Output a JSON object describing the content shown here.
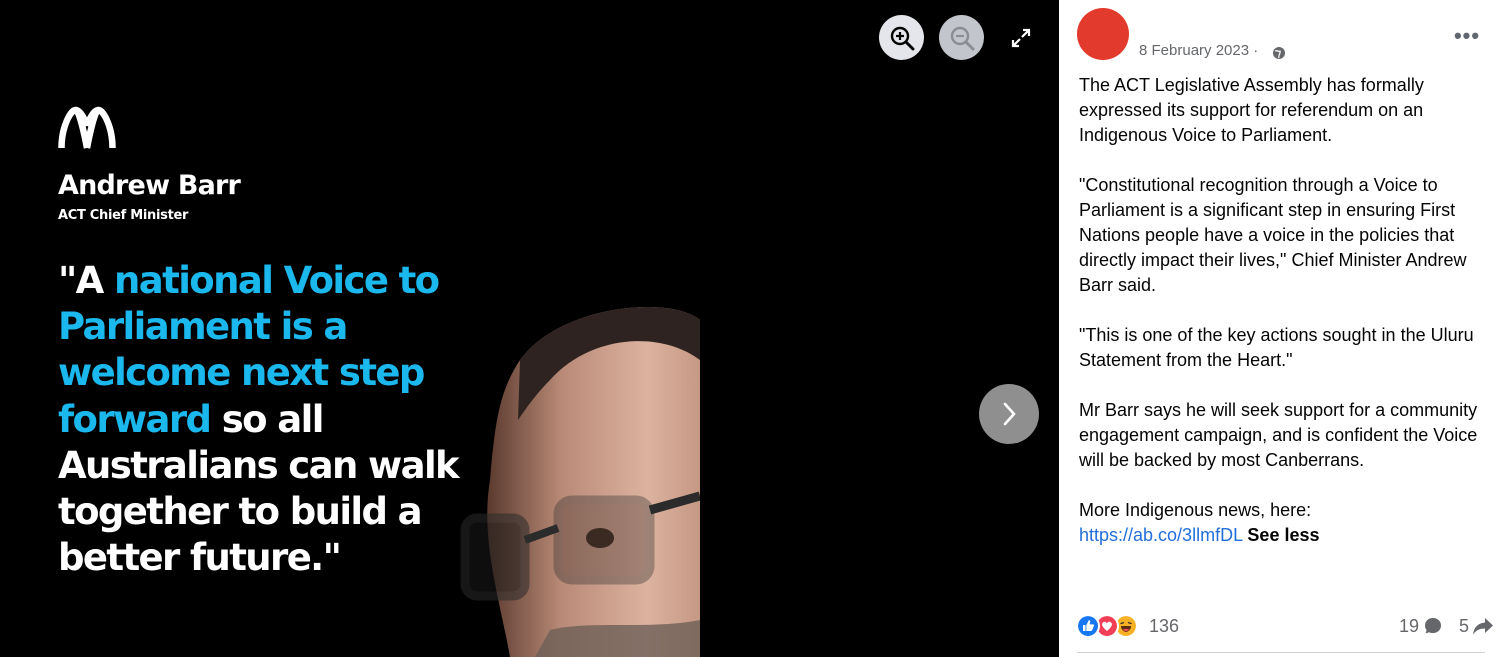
{
  "media": {
    "logo": "ABC",
    "author_name": "Andrew Barr",
    "author_role": "ACT Chief Minister",
    "quote": {
      "part1": "\"A ",
      "highlight": "national Voice to Parliament is a welcome next step forward",
      "part2": " so all Australians can walk together to build a better future.\""
    },
    "highlight_color": "#1bb8ee",
    "controls": {
      "zoom_in_icon": "zoom-in-icon",
      "zoom_out_icon": "zoom-out-icon",
      "fullscreen_icon": "fullscreen-icon",
      "next_icon": "chevron-right-icon"
    }
  },
  "post": {
    "date": "8 February 2023 ·",
    "privacy_icon": "globe-icon",
    "more_label": "•••",
    "paragraphs": [
      "The ACT Legislative Assembly has formally expressed its support for referendum on an Indigenous Voice to Parliament.",
      "\"Constitutional recognition through a Voice to Parliament is a significant step in ensuring First Nations people have a voice in the policies that directly impact their lives,\" Chief Minister Andrew Barr said.",
      "\"This is one of the key actions sought in the Uluru Statement from the Heart.\"",
      "Mr Barr says he will seek support for a community engagement campaign, and is confident the Voice will be backed by most Canberrans."
    ],
    "more_news_label": "More Indigenous news, here:",
    "link": "https://ab.co/3llmfDL",
    "see_less": "See less",
    "link_color": "#216fdb"
  },
  "reactions": {
    "icons": [
      "like-icon",
      "love-icon",
      "haha-icon"
    ],
    "count": "136",
    "comments": "19",
    "shares": "5"
  }
}
